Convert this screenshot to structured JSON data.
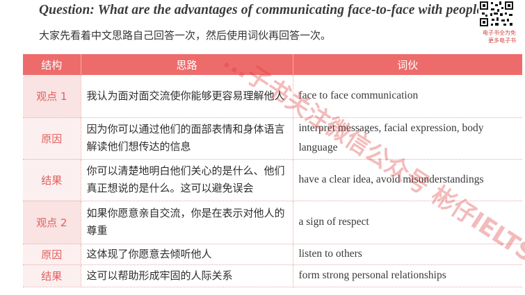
{
  "question": "Question: What are the advantages of communicating face-to-face with people?",
  "instruction": "大家先看着中文思路自己回答一次，然后使用词伙再回答一次。",
  "qr_caption": [
    "电子书全为免",
    "更多电子书"
  ],
  "table": {
    "headers": [
      "结构",
      "思路",
      "词伙"
    ],
    "rows": [
      {
        "structure": "观点 1",
        "idea": "我认为面对面交流使你能够更容易理解他人",
        "vocab": "face to face communication"
      },
      {
        "structure": "原因",
        "idea": "因为你可以通过他们的面部表情和身体语言解读他们想传达的信息",
        "vocab": "interpret messages, facial expression, body language"
      },
      {
        "structure": "结果",
        "idea": "你可以清楚地明白他们关心的是什么、他们真正想说的是什么。这可以避免误会",
        "vocab": "have a clear idea, avoid misunderstandings"
      },
      {
        "structure": "观点 2",
        "idea": "如果你愿意亲自交流，你是在表示对他人的尊重",
        "vocab": "a sign of respect"
      },
      {
        "structure": "原因",
        "idea": "这体现了你愿意去倾听他人",
        "vocab": "listen to others"
      },
      {
        "structure": "结果",
        "idea": "这可以帮助形成牢固的人际关系",
        "vocab": "form strong personal relationships"
      }
    ]
  },
  "watermark": "...子书关注微信公众号 彬仔IELTS下载",
  "colors": {
    "header_bg": "#ee6b6b",
    "structure_text": "#e0605f",
    "watermark": "#dc3c3c"
  }
}
